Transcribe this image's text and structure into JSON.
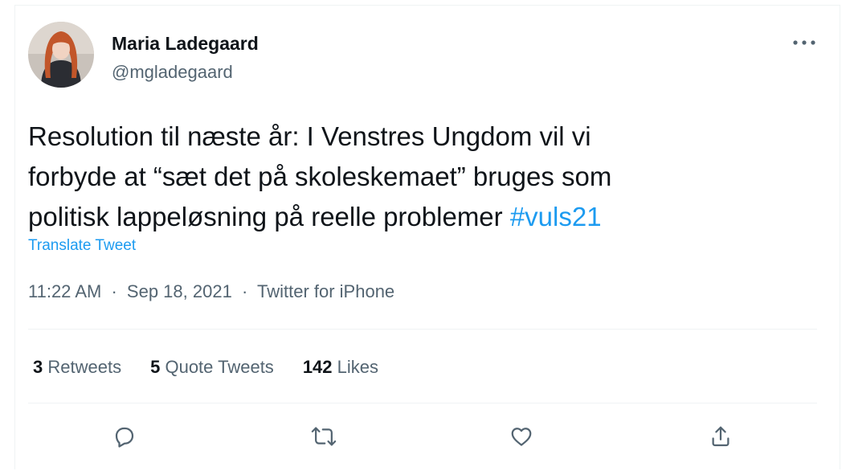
{
  "author": {
    "display_name": "Maria Ladegaard",
    "handle": "@mgladegaard",
    "avatar_icon": "profile-photo"
  },
  "tweet": {
    "text_lines": [
      "Resolution til næste år: I Venstres Ungdom vil vi",
      "forbyde at “sæt det på skoleskemaet” bruges som",
      "politisk lappeløsning på reelle problemer "
    ],
    "hashtag": "#vuls21",
    "translate_label": "Translate Tweet"
  },
  "meta": {
    "time": "11:22 AM",
    "separator": "·",
    "date": "Sep 18, 2021",
    "source": "Twitter for iPhone"
  },
  "stats": {
    "retweets_count": "3",
    "retweets_label": "Retweets",
    "quote_tweets_count": "5",
    "quote_tweets_label": "Quote Tweets",
    "likes_count": "142",
    "likes_label": "Likes"
  },
  "actions": {
    "reply_icon": "reply-icon",
    "retweet_icon": "retweet-icon",
    "like_icon": "heart-icon",
    "share_icon": "share-icon",
    "more_icon": "more-horizontal-icon"
  },
  "colors": {
    "text_primary": "#0f1419",
    "text_secondary": "#536471",
    "accent_blue": "#1d9bf0",
    "divider": "#eff3f4"
  }
}
